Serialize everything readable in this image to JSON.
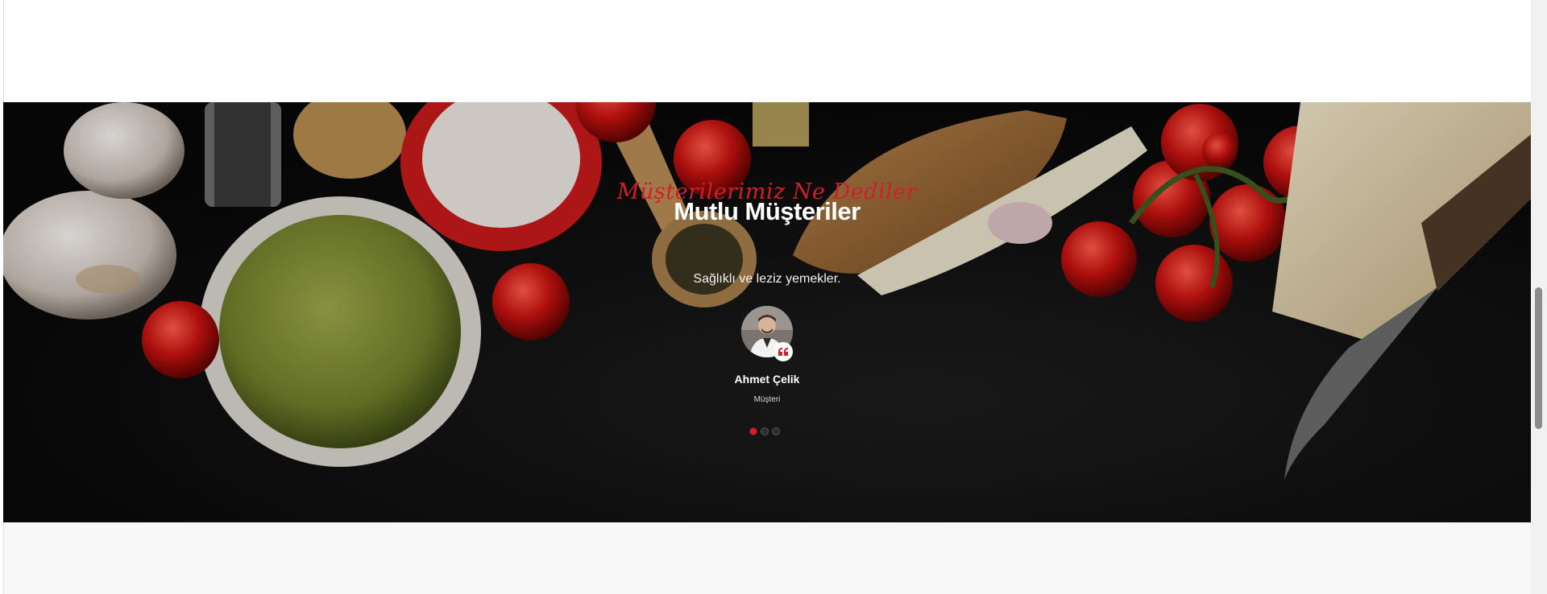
{
  "testimonials": {
    "subtitle_script": "Müşterilerimiz Ne Dediler",
    "title": "Mutlu Müşteriler",
    "quote": "Sağlıklı ve leziz yemekler.",
    "author": {
      "name": "Ahmet Çelik",
      "role": "Müşteri"
    },
    "slider": {
      "count": 3,
      "active_index": 0
    }
  },
  "icons": {
    "quote": "quote-icon"
  },
  "colors": {
    "accent": "#d21e2b",
    "section_background": "#0b0b0b",
    "title": "#ffffff",
    "page_background": "#ffffff",
    "footer_background": "#f8f8f8"
  }
}
